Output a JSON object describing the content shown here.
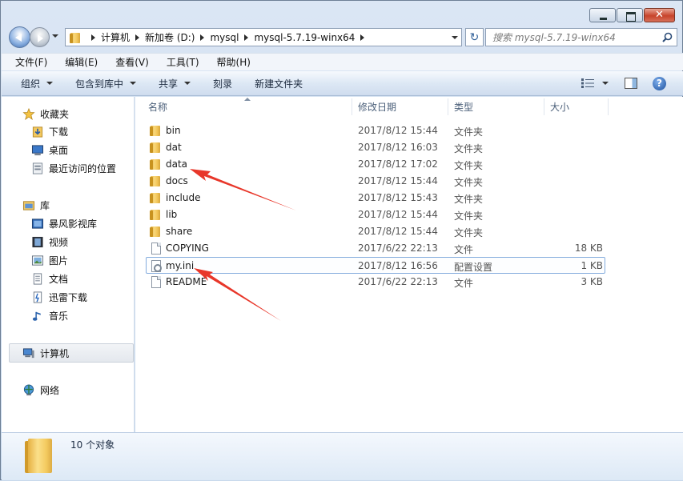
{
  "window": {
    "caption": {
      "close_glyph": "✕"
    }
  },
  "address": {
    "crumbs": [
      "计算机",
      "新加卷 (D:)",
      "mysql",
      "mysql-5.7.19-winx64"
    ],
    "refresh_glyph": "↻"
  },
  "search": {
    "placeholder": "搜索 mysql-5.7.19-winx64"
  },
  "menubar": [
    "文件(F)",
    "编辑(E)",
    "查看(V)",
    "工具(T)",
    "帮助(H)"
  ],
  "toolbar": {
    "organize": "组织",
    "include_in_library": "包含到库中",
    "share": "共享",
    "burn": "刻录",
    "new_folder": "新建文件夹",
    "help_glyph": "?"
  },
  "navpane": {
    "favorites": "收藏夹",
    "downloads": "下载",
    "desktop": "桌面",
    "recent": "最近访问的位置",
    "libraries": "库",
    "storm": "暴风影视库",
    "videos": "视频",
    "pictures": "图片",
    "documents": "文档",
    "thunder": "迅雷下载",
    "music": "音乐",
    "computer": "计算机",
    "network": "网络"
  },
  "columns": {
    "name": "名称",
    "date": "修改日期",
    "type": "类型",
    "size": "大小"
  },
  "files": [
    {
      "name": "bin",
      "date": "2017/8/12 15:44",
      "type": "文件夹",
      "size": "",
      "kind": "folder"
    },
    {
      "name": "dat",
      "date": "2017/8/12 16:03",
      "type": "文件夹",
      "size": "",
      "kind": "folder"
    },
    {
      "name": "data",
      "date": "2017/8/12 17:02",
      "type": "文件夹",
      "size": "",
      "kind": "folder"
    },
    {
      "name": "docs",
      "date": "2017/8/12 15:44",
      "type": "文件夹",
      "size": "",
      "kind": "folder"
    },
    {
      "name": "include",
      "date": "2017/8/12 15:43",
      "type": "文件夹",
      "size": "",
      "kind": "folder"
    },
    {
      "name": "lib",
      "date": "2017/8/12 15:44",
      "type": "文件夹",
      "size": "",
      "kind": "folder"
    },
    {
      "name": "share",
      "date": "2017/8/12 15:44",
      "type": "文件夹",
      "size": "",
      "kind": "folder"
    },
    {
      "name": "COPYING",
      "date": "2017/6/22 22:13",
      "type": "文件",
      "size": "18 KB",
      "kind": "file"
    },
    {
      "name": "my.ini",
      "date": "2017/8/12 16:56",
      "type": "配置设置",
      "size": "1 KB",
      "kind": "ini"
    },
    {
      "name": "README",
      "date": "2017/6/22 22:13",
      "type": "文件",
      "size": "3 KB",
      "kind": "file"
    }
  ],
  "status": {
    "count": "10 个对象"
  },
  "colors": {
    "annotation_arrow": "#e8372a",
    "selection_border": "#84acdd"
  }
}
